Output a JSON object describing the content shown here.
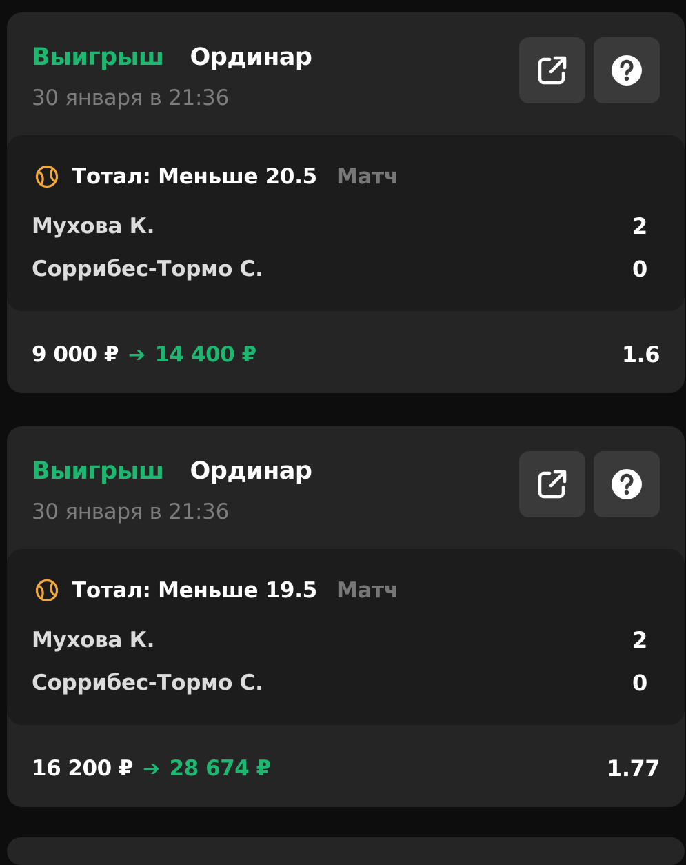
{
  "bets": [
    {
      "status": "Выигрыш",
      "type": "Ординар",
      "date": "30 января в 21:36",
      "market": "Тотал: Меньше 20.5",
      "period": "Матч",
      "sport_icon": "tennis-ball-icon",
      "teams": [
        {
          "name": "Мухова К.",
          "score": "2"
        },
        {
          "name": "Соррибес-Тормо С.",
          "score": "0"
        }
      ],
      "stake": "9 000 ₽",
      "payout": "14 400 ₽",
      "odds": "1.6"
    },
    {
      "status": "Выигрыш",
      "type": "Ординар",
      "date": "30 января в 21:36",
      "market": "Тотал: Меньше 19.5",
      "period": "Матч",
      "sport_icon": "tennis-ball-icon",
      "teams": [
        {
          "name": "Мухова К.",
          "score": "2"
        },
        {
          "name": "Соррибес-Тормо С.",
          "score": "0"
        }
      ],
      "stake": "16 200 ₽",
      "payout": "28 674 ₽",
      "odds": "1.77"
    }
  ],
  "colors": {
    "win_green": "#1db86f",
    "card_bg": "#252525",
    "event_bg": "#1c1c1c",
    "icon_accent": "#f0a83a"
  }
}
